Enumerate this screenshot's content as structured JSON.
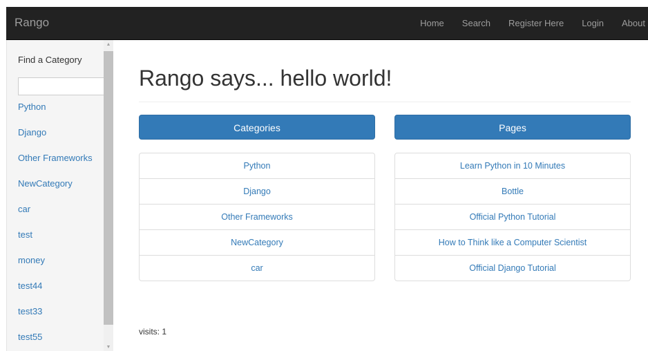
{
  "navbar": {
    "brand": "Rango",
    "links": [
      "Home",
      "Search",
      "Register Here",
      "Login",
      "About"
    ]
  },
  "sidebar": {
    "find_label": "Find a Category",
    "search_value": "",
    "categories": [
      "Python",
      "Django",
      "Other Frameworks",
      "NewCategory",
      "car",
      "test",
      "money",
      "test44",
      "test33",
      "test55"
    ]
  },
  "main": {
    "heading": "Rango says... hello world!",
    "categories_button": "Categories",
    "pages_button": "Pages",
    "categories": [
      "Python",
      "Django",
      "Other Frameworks",
      "NewCategory",
      "car"
    ],
    "pages": [
      "Learn Python in 10 Minutes",
      "Bottle",
      "Official Python Tutorial",
      "How to Think like a Computer Scientist",
      "Official Django Tutorial"
    ],
    "visits": "visits: 1"
  },
  "colors": {
    "navbar_bg": "#222222",
    "nav_text": "#9d9d9d",
    "link": "#337ab7",
    "button_bg": "#337ab7",
    "sidebar_bg": "#f5f5f5"
  }
}
